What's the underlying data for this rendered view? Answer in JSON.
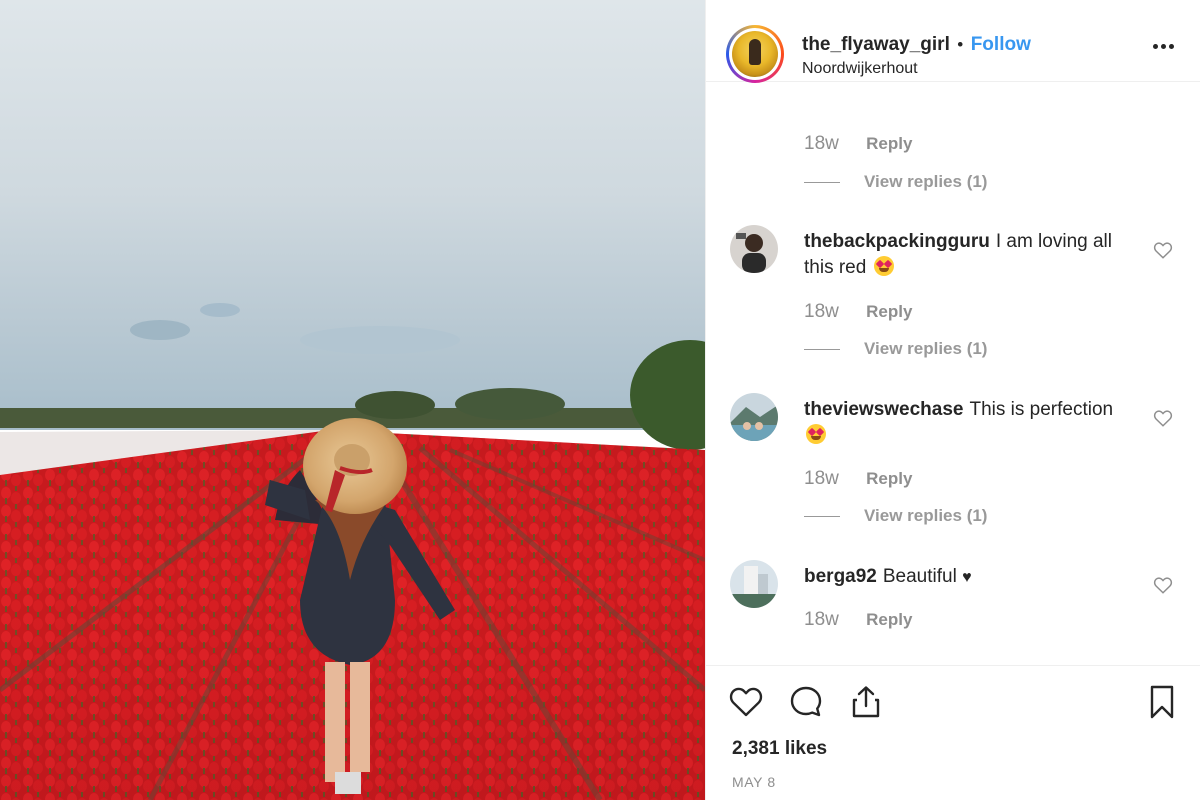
{
  "post": {
    "username": "the_flyaway_girl",
    "separator": "•",
    "follow_label": "Follow",
    "location": "Noordwijkerhout",
    "more_icon": "more-options-icon"
  },
  "first_meta": {
    "time": "18w",
    "reply_label": "Reply",
    "view_replies": "View replies (1)"
  },
  "comments": [
    {
      "username": "thebackpackingguru",
      "text": "I am loving all this red",
      "emoji": "heart-eyes-emoji",
      "time": "18w",
      "reply_label": "Reply",
      "view_replies": "View replies (1)"
    },
    {
      "username": "theviewswechase",
      "text": "This is perfection",
      "emoji": "heart-eyes-emoji",
      "time": "18w",
      "reply_label": "Reply",
      "view_replies": "View replies (1)"
    },
    {
      "username": "berga92",
      "text": "Beautiful",
      "emoji": "black-heart",
      "suffix": "♥",
      "time": "18w",
      "reply_label": "Reply"
    }
  ],
  "footer": {
    "likes": "2,381 likes",
    "date": "MAY 8"
  },
  "icons": [
    "like-icon",
    "comment-icon",
    "share-icon",
    "bookmark-icon"
  ],
  "colors": {
    "link_blue": "#3897f0",
    "text": "#262626",
    "muted": "#8e8e8e",
    "border": "#efefef"
  }
}
